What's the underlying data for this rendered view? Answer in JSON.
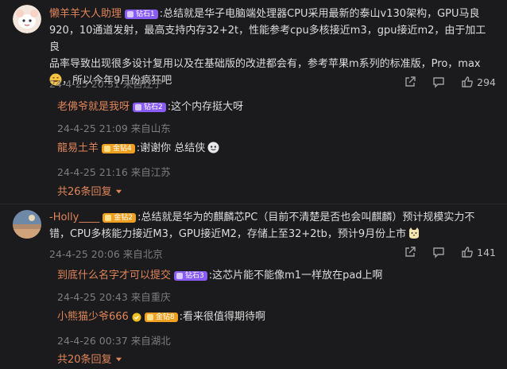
{
  "comments": [
    {
      "username": "懒羊羊大人助理",
      "badge": "钻石1",
      "text_line1": ":总结就是华子电脑端处理器CPU采用最新的泰山v130架构，GPU马良",
      "text_line2": "920，10通道发射，最高支持内存32+2t，性能参考cpu多核接近m3，gpu接近m2，由于加工良",
      "text_line3": "品率导致出现很多设计复用以及在基础版的改进都会有，参考苹果m系列的标准版，Pro，max",
      "text_line4": "，所以今年9月份疯狂吧",
      "meta": "24-4-25 20:31 来自辽宁",
      "likes": "294",
      "replies": [
        {
          "username": "老佛爷就是我呀",
          "badge": "钻石2",
          "text": ":这个内存挺大呀",
          "meta": "24-4-25 21:09 来自山东"
        },
        {
          "username": "龍易土羊",
          "badge": "金钻4",
          "text": ":谢谢你 总结侠",
          "meta": "24-4-25 21:16 来自江苏"
        }
      ],
      "more_replies": "共26条回复"
    },
    {
      "username": "-Holly____",
      "badge": "金钻2",
      "text_line1": ":总结就是华为的麒麟芯PC（目前不清楚是否也会叫麒麟）预计规模实力不",
      "text_line2": "错，CPU多核能力接近M3，GPU接近M2，存储上至32+2tb，预计9月份上市",
      "meta": "24-4-25 20:06 来自北京",
      "likes": "141",
      "replies": [
        {
          "username": "到底什么名字才可以提交",
          "badge": "钻石3",
          "text": ":这芯片能不能像m1一样放在pad上啊",
          "meta": "24-4-25 20:43 来自重庆"
        },
        {
          "username": "小熊猫少爷666",
          "badge": "金钻8",
          "text": ":看来很值得期待啊",
          "meta": "24-4-26 00:37 来自湖北"
        }
      ],
      "more_replies": "共20条回复"
    }
  ],
  "icons": [
    "share-icon",
    "comment-icon",
    "like-icon",
    "chevron-down-icon"
  ],
  "colors": {
    "background": "#1b1b1d",
    "username": "#e0855a",
    "meta": "#7d7d7d",
    "badge_purple": "#8a5cf6",
    "badge_gold": "#f0a020"
  }
}
